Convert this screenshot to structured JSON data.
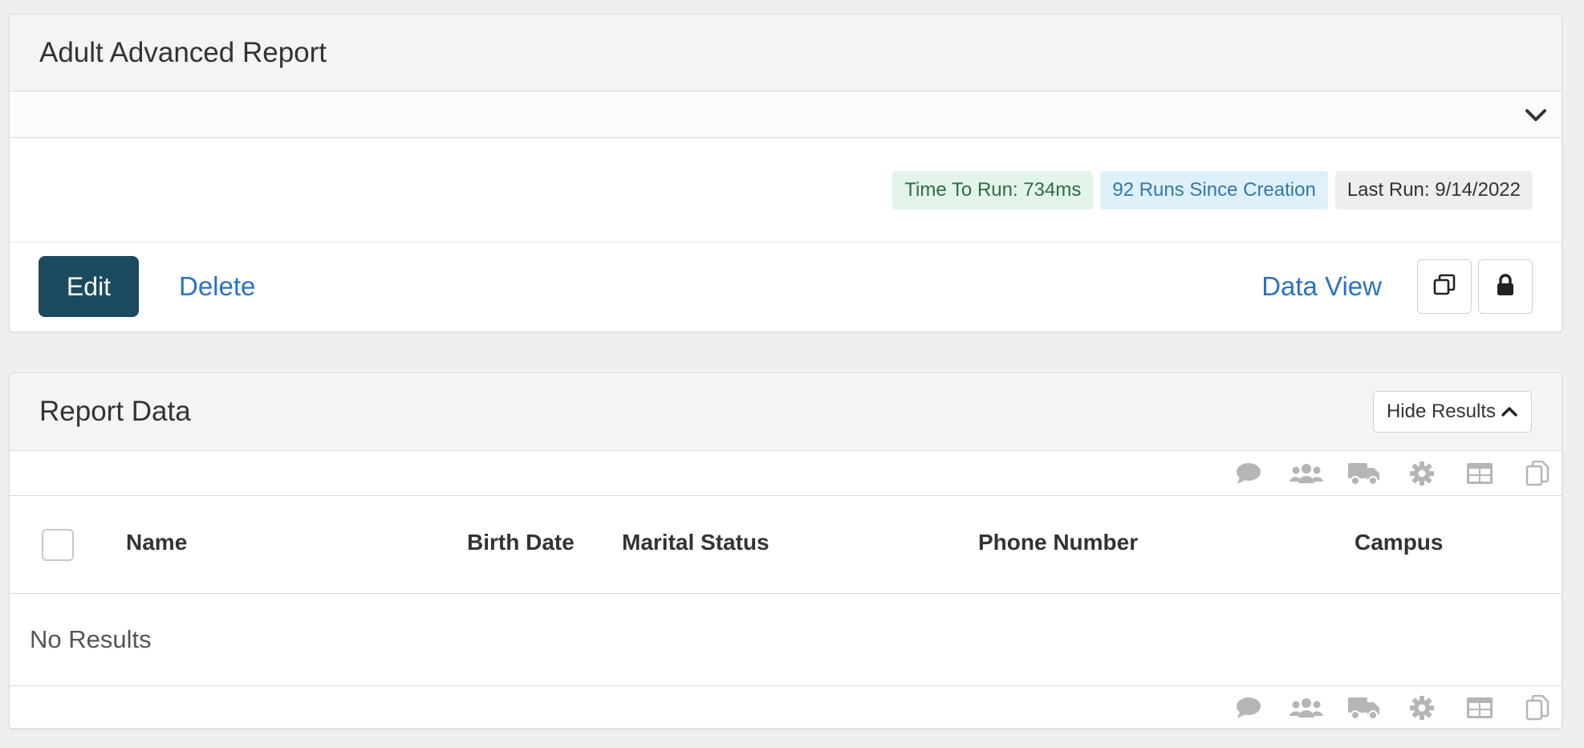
{
  "report": {
    "title": "Adult Advanced Report",
    "badges": {
      "time_to_run": "Time To Run: 734ms",
      "runs": "92 Runs Since Creation",
      "last_run": "Last Run: 9/14/2022"
    },
    "actions": {
      "edit": "Edit",
      "delete": "Delete",
      "data_view": "Data View"
    }
  },
  "report_data": {
    "title": "Report Data",
    "hide_results": "Hide Results",
    "columns": [
      "Name",
      "Birth Date",
      "Marital Status",
      "Phone Number",
      "Campus"
    ],
    "empty_text": "No Results",
    "grid_action_icons": [
      "communicate-icon",
      "merge-people-icon",
      "bulk-update-icon",
      "settings-icon",
      "excel-export-icon",
      "merge-template-icon"
    ]
  },
  "colors": {
    "primary": "#1c4a5f",
    "link": "#2a72c3",
    "success_bg": "#e3f5ea",
    "info_bg": "#def1fb",
    "icon_gray": "#b5b5b5"
  }
}
